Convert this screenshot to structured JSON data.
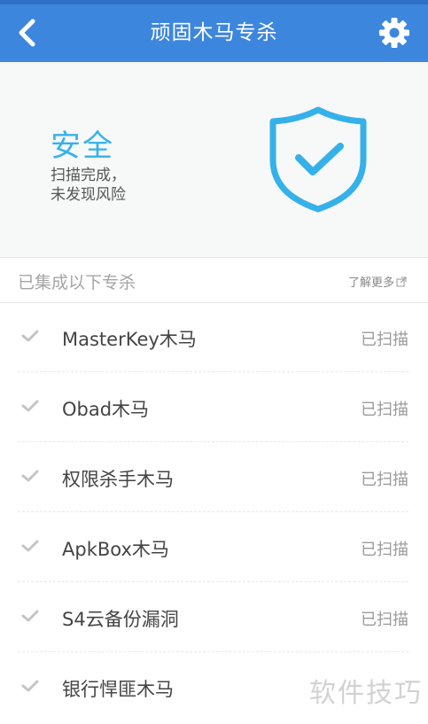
{
  "header": {
    "title": "顽固木马专杀",
    "back_icon": "chevron-left-icon",
    "settings_icon": "gear-icon",
    "color": "#3d86dd"
  },
  "status": {
    "title": "安全",
    "line1": "扫描完成，",
    "line2": "未发现风险",
    "icon": "shield-check-icon",
    "accent": "#35b1ea"
  },
  "section": {
    "title": "已集成以下专杀",
    "learn_more": "了解更多"
  },
  "items": [
    {
      "name": "MasterKey木马",
      "status": "已扫描"
    },
    {
      "name": "Obad木马",
      "status": "已扫描"
    },
    {
      "name": "权限杀手木马",
      "status": "已扫描"
    },
    {
      "name": "ApkBox木马",
      "status": "已扫描"
    },
    {
      "name": "S4云备份漏洞",
      "status": "已扫描"
    },
    {
      "name": "银行悍匪木马",
      "status": ""
    }
  ],
  "watermark": "软件技巧"
}
